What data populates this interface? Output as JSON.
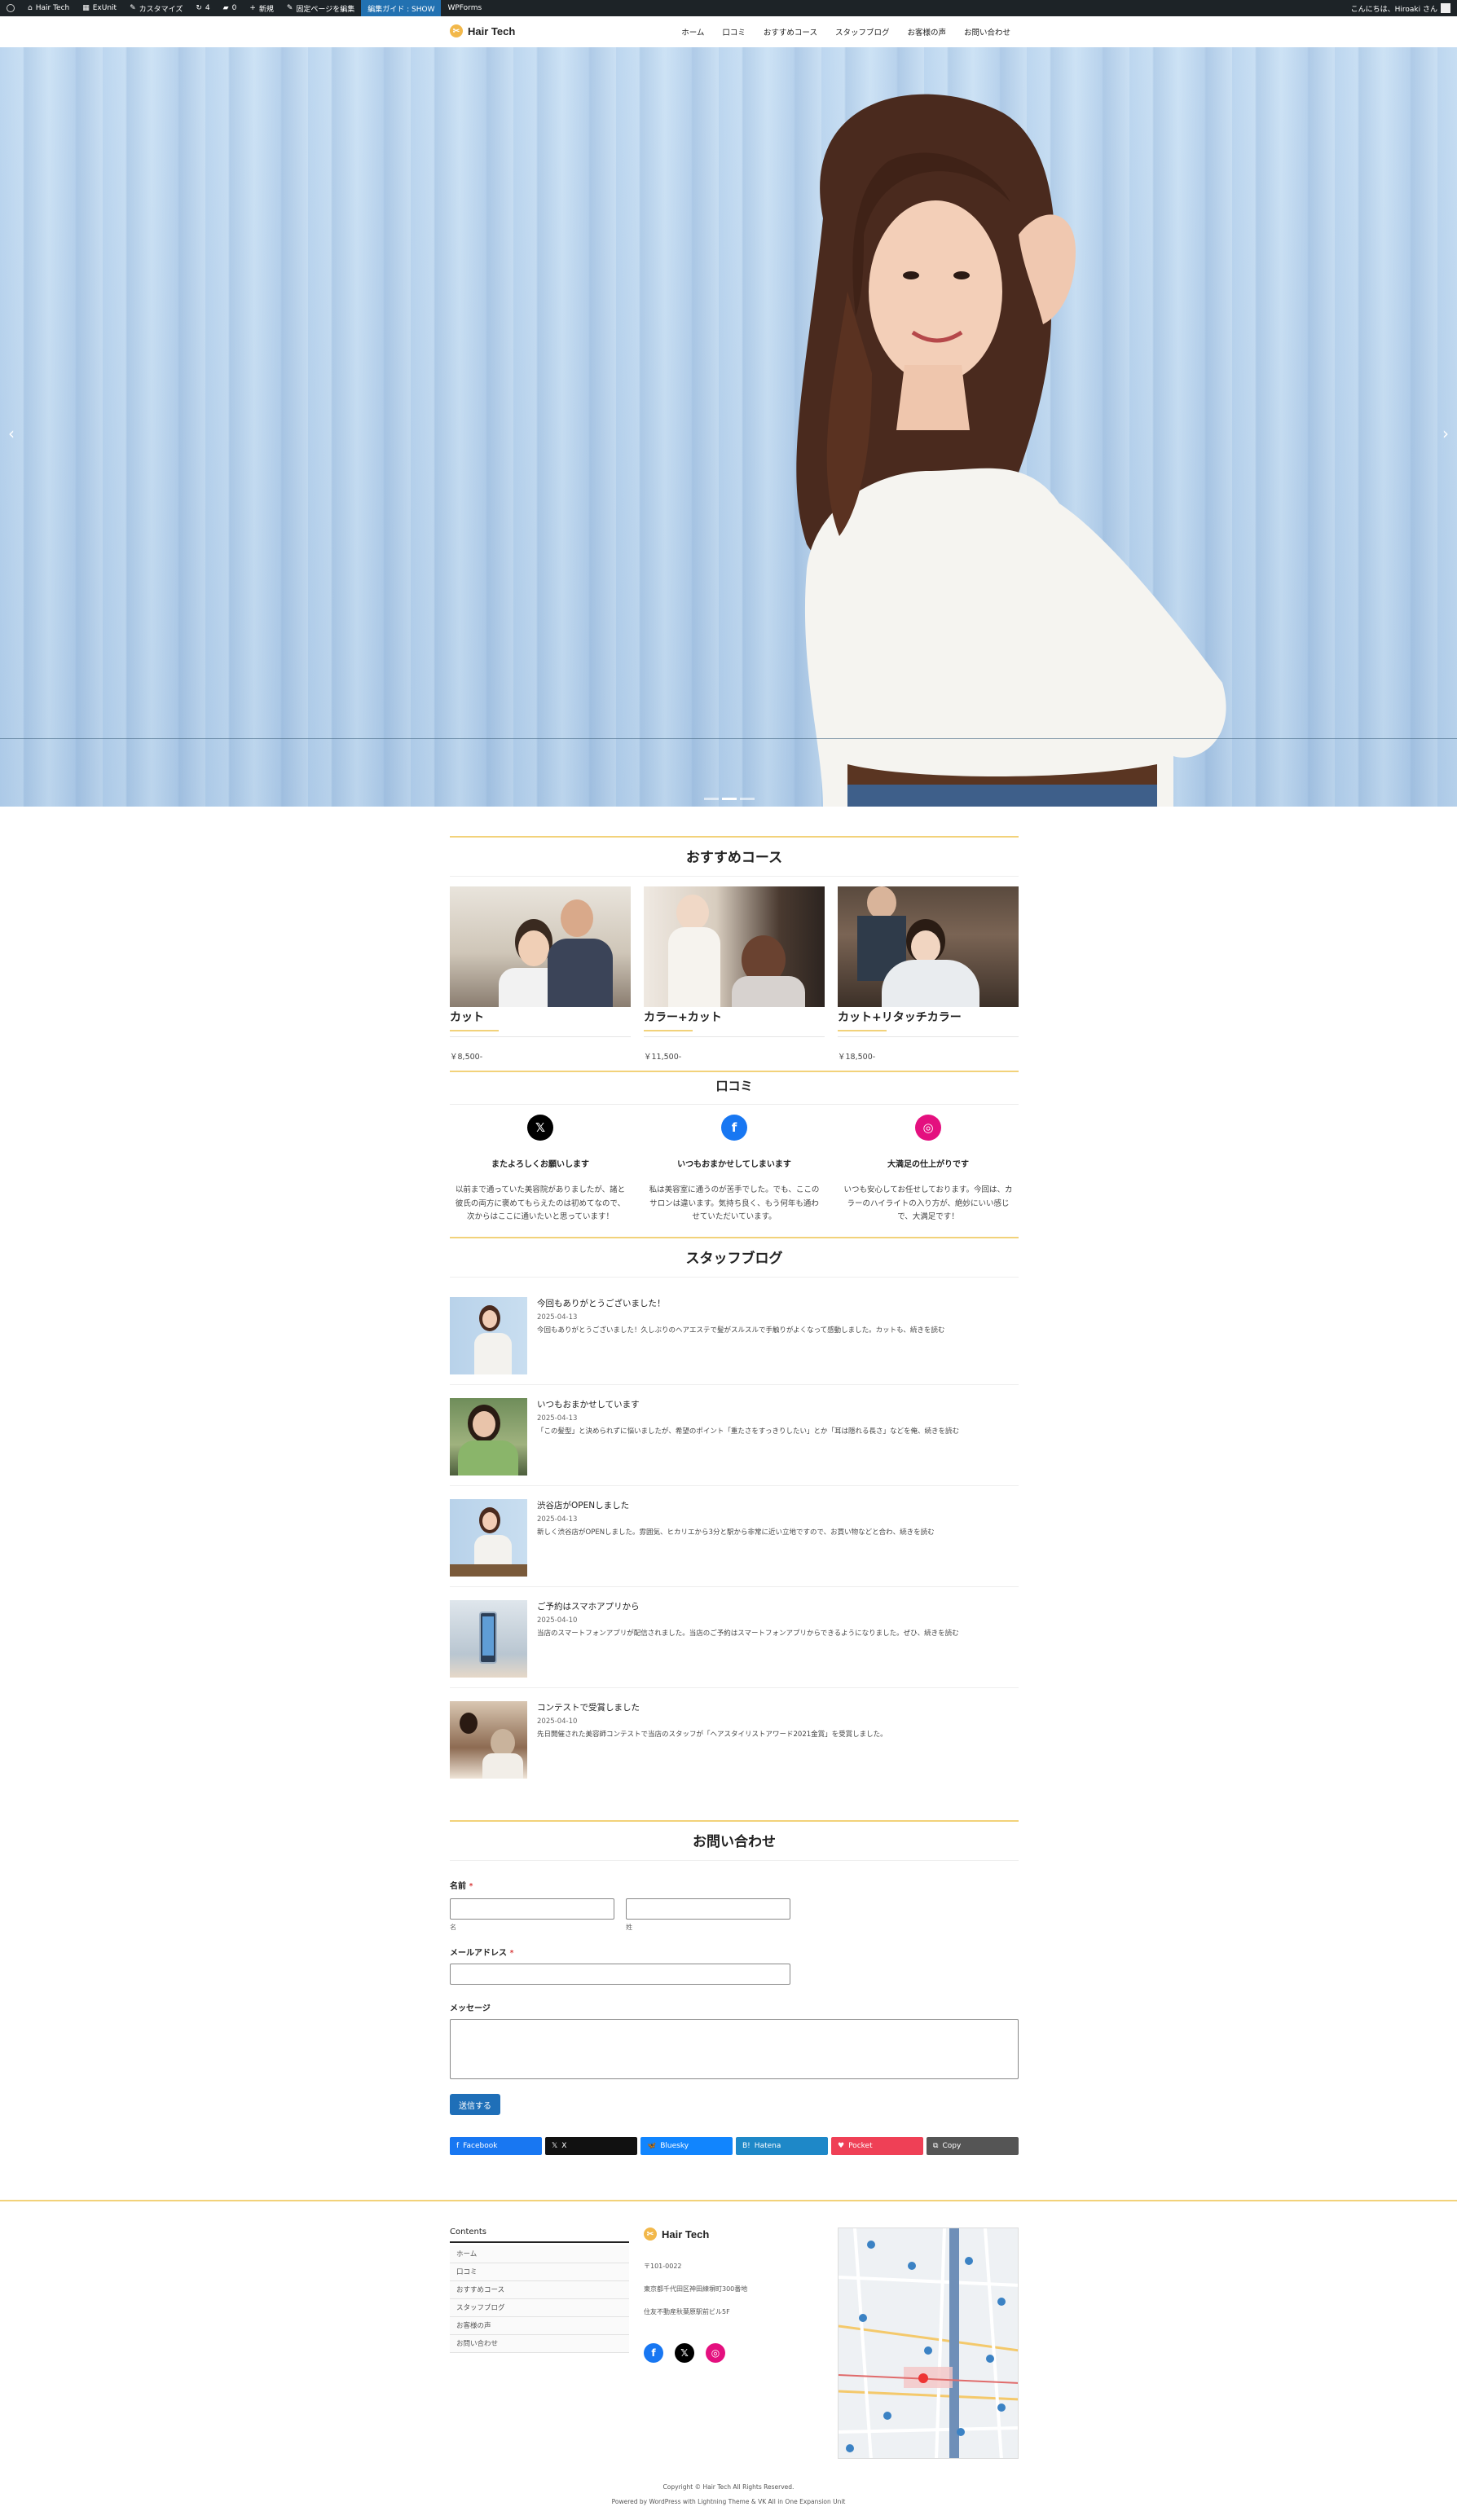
{
  "adminbar": {
    "site": "Hair Tech",
    "exunit": "ExUnit",
    "customize": "カスタマイズ",
    "updates": "4",
    "comments": "0",
    "new": "新規",
    "edit_fixed": "固定ページを編集",
    "edit_guide": "編集ガイド : SHOW",
    "wpforms": "WPForms",
    "greeting": "こんにちは、Hiroaki さん"
  },
  "header": {
    "logo": "Hair Tech",
    "nav": [
      "ホーム",
      "口コミ",
      "おすすめコース",
      "スタッフブログ",
      "お客様の声",
      "お問い合わせ"
    ]
  },
  "courses": {
    "title": "おすすめコース",
    "items": [
      {
        "name": "カット",
        "price": "￥8,500-"
      },
      {
        "name": "カラー+カット",
        "price": "￥11,500-"
      },
      {
        "name": "カット+リタッチカラー",
        "price": "￥18,500-"
      }
    ]
  },
  "reviews": {
    "title": "口コミ",
    "items": [
      {
        "icon": "x-icon",
        "color": "#000000",
        "title": "またよろしくお願いします",
        "body": "以前まで通っていた美容院がありましたが、諸と彼氏の両方に褒めてもらえたのは初めてなので、次からはここに通いたいと思っています！"
      },
      {
        "icon": "facebook-icon",
        "color": "#1877f2",
        "title": "いつもおまかせしてしまいます",
        "body": "私は美容室に通うのが苦手でした。でも、ここのサロンは違います。気持ち良く、もう何年も通わせていただいています。"
      },
      {
        "icon": "instagram-icon",
        "color": "#e4107f",
        "title": "大満足の仕上がりです",
        "body": "いつも安心してお任せしております。今回は、カラーのハイライトの入り方が、絶妙にいい感じで、大満足です！"
      }
    ]
  },
  "blog": {
    "title": "スタッフブログ",
    "posts": [
      {
        "title": "今回もありがとうございました！",
        "date": "2025-04-13",
        "excerpt": "今回もありがとうございました！久しぶりのヘアエステで髪がスルスルで手触りがよくなって感動しました。カットも、続きを読む"
      },
      {
        "title": "いつもおまかせしています",
        "date": "2025-04-13",
        "excerpt": "「この髪型」と決められずに悩いましたが、希望のポイント「重たさをすっきりしたい」とか「耳は隠れる長さ」などを俺、続きを読む"
      },
      {
        "title": "渋谷店がOPENしました",
        "date": "2025-04-13",
        "excerpt": "新しく渋谷店がOPENしました。雰囲気、ヒカリエから3分と駅から非常に近い立地ですので、お買い物などと合わ、続きを読む"
      },
      {
        "title": "ご予約はスマホアプリから",
        "date": "2025-04-10",
        "excerpt": "当店のスマートフォンアプリが配信されました。当店のご予約はスマートフォンアプリからできるようになりました。ぜひ、続きを読む"
      },
      {
        "title": "コンテストで受賞しました",
        "date": "2025-04-10",
        "excerpt": "先日開催された美容師コンテストで当店のスタッフが「ヘアスタイリストアワード2021金賞」を受賞しました。"
      }
    ]
  },
  "contact": {
    "title": "お問い合わせ",
    "name_label": "名前",
    "required_mark": "*",
    "first_sub": "名",
    "last_sub": "姓",
    "email_label": "メールアドレス",
    "message_label": "メッセージ",
    "submit": "送信する"
  },
  "share": [
    {
      "label": "Facebook",
      "icon": "facebook-icon",
      "color": "#1877f2"
    },
    {
      "label": "X",
      "icon": "x-icon",
      "color": "#111111"
    },
    {
      "label": "Bluesky",
      "icon": "bluesky-icon",
      "color": "#1185fe"
    },
    {
      "label": "Hatena",
      "icon": "hatena-icon",
      "color": "#1e88c8"
    },
    {
      "label": "Pocket",
      "icon": "pocket-icon",
      "color": "#ef4056"
    },
    {
      "label": "Copy",
      "icon": "copy-icon",
      "color": "#555555"
    }
  ],
  "footer": {
    "contents_title": "Contents",
    "menu": [
      "ホーム",
      "口コミ",
      "おすすめコース",
      "スタッフブログ",
      "お客様の声",
      "お問い合わせ"
    ],
    "logo": "Hair Tech",
    "postal": "〒101-0022",
    "address": "東京都千代田区神田練塀町300番地",
    "building": "住友不動産秋葉原駅前ビル5F",
    "copyright": "Copyright © Hair Tech All Rights Reserved.",
    "powered": "Powered by WordPress with Lightning Theme & VK All in One Expansion Unit"
  },
  "colors": {
    "accent": "#f2d27a",
    "button": "#1f6fb8",
    "adminbar": "#1d2327"
  }
}
